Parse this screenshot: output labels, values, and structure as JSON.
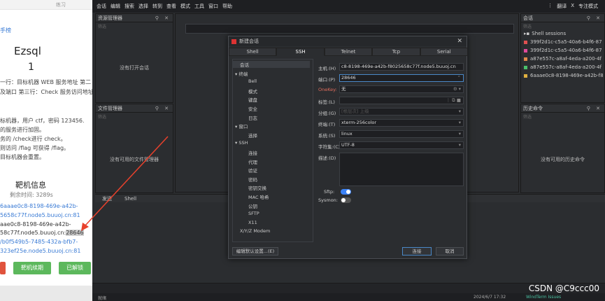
{
  "web": {
    "tab_text": "练习",
    "rank_link": "手榜",
    "challenge_title": "Ezsql",
    "score": "1",
    "desc_lines": [
      "一行：目标机器 WEB 服务地址 第二",
      "及端口 第三行：Check 服务访问地址",
      "标机器，用户 ctf，密码 123456.",
      "的服务进行加固。",
      "务的 /check进行 check。",
      "则访问 /flag 可获得 /flag。",
      "目标机器会重置。"
    ],
    "target_info_title": "靶机信息",
    "time_left": "剩余时间: 3289s",
    "link1a": "6aaae0c8-8198-469e-a42b-",
    "link1b": "5658c77f.node5.buuoj.cn:81",
    "host_line_a": "aae0c8-8198-469e-a42b-",
    "host_line_b": "58c77f.node5.buuoj.cn:",
    "host_port": "28646",
    "link2a": "/b0f549b5-7485-432a-bfb7-",
    "link2b": "323ef25e.node5.buuoj.cn:81",
    "btn_renew": "靶机续期",
    "btn_solved": "已解锁"
  },
  "menubar": {
    "items": [
      "会话",
      "编辑",
      "搜索",
      "选择",
      "转到",
      "查看",
      "模式",
      "工具",
      "窗口",
      "帮助"
    ],
    "right": [
      "翻译",
      "专注模式"
    ]
  },
  "panels": {
    "resource_manager": {
      "title": "资源管理器",
      "filter": "筛选",
      "empty": "没有打开会话"
    },
    "file_manager": {
      "title": "文件管理器",
      "filter": "筛选",
      "empty": "没有可用的文件管理器"
    },
    "sessions": {
      "title": "会话",
      "filter": "筛选",
      "folder": "Shell sessions",
      "items": [
        {
          "label": "399f2d1c-c5a5-40a6-b4f6-87",
          "color": "#e05050"
        },
        {
          "label": "399f2d1c-c5a5-40a6-b4f6-87",
          "color": "#e04a9a"
        },
        {
          "label": "a87e557c-a8af-4eda-a200-4f",
          "color": "#e08a4a"
        },
        {
          "label": "a87e557c-a8af-4eda-a200-4f",
          "color": "#4ac06a"
        },
        {
          "label": "6aaae0c8-8198-469e-a42b-f8",
          "color": "#e0b040"
        }
      ]
    },
    "history": {
      "title": "历史命令",
      "filter": "筛选",
      "empty": "没有可用的历史命令"
    },
    "terminal_tabs": [
      "发送",
      "Shell"
    ]
  },
  "dialog": {
    "title": "新建会话",
    "tabs": [
      "Shell",
      "SSH",
      "Telnet",
      "Tcp",
      "Serial"
    ],
    "active_tab": "SSH",
    "tree": [
      {
        "label": "会话",
        "level": 0,
        "arrow": ""
      },
      {
        "label": "终端",
        "level": 0,
        "arrow": "▾"
      },
      {
        "label": "Bell",
        "level": 1,
        "arrow": ""
      },
      {
        "label": "模式",
        "level": 1,
        "arrow": ""
      },
      {
        "label": "键盘",
        "level": 1,
        "arrow": ""
      },
      {
        "label": "安全",
        "level": 1,
        "arrow": ""
      },
      {
        "label": "日志",
        "level": 1,
        "arrow": ""
      },
      {
        "label": "窗口",
        "level": 0,
        "arrow": "▾"
      },
      {
        "label": "选择",
        "level": 1,
        "arrow": ""
      },
      {
        "label": "SSH",
        "level": 0,
        "arrow": "▾"
      },
      {
        "label": "连接",
        "level": 1,
        "arrow": ""
      },
      {
        "label": "代理",
        "level": 1,
        "arrow": ""
      },
      {
        "label": "验证",
        "level": 1,
        "arrow": ""
      },
      {
        "label": "密码",
        "level": 1,
        "arrow": ""
      },
      {
        "label": "密钥交换",
        "level": 1,
        "arrow": ""
      },
      {
        "label": "MAC 哈希",
        "level": 1,
        "arrow": ""
      },
      {
        "label": "公钥",
        "level": 1,
        "arrow": ""
      },
      {
        "label": "SFTP",
        "level": 1,
        "arrow": ""
      },
      {
        "label": "X11",
        "level": 1,
        "arrow": ""
      },
      {
        "label": "X/Y/Z Modem",
        "level": 0,
        "arrow": ""
      }
    ],
    "fields": {
      "host_label": "主机:(H)",
      "host_value": "c8-8198-469e-a42b-f8025658c77f.node5.buuoj.cn",
      "port_label": "端口:(P)",
      "port_value": "28646",
      "onekey_label": "OneKey:",
      "onekey_value": "无",
      "tag_label": "标签:(L)",
      "tag_value": "",
      "group_label": "分组:(G)",
      "group_value": "[根层次] 上级",
      "term_label": "终端:(T)",
      "term_value": "xterm-256color",
      "system_label": "系统:(S)",
      "system_value": "linux",
      "charset_label": "字符集:(C)",
      "charset_value": "UTF-8",
      "desc_label": "描述:(D)",
      "sftp_label": "Sftp:",
      "sftp_on": true,
      "sysmon_label": "Sysmon:",
      "sysmon_on": false
    },
    "edit_defaults": "编辑默认设置...(E)",
    "connect": "连接",
    "cancel": "取消"
  },
  "status": {
    "left": "就绪",
    "datetime": "2024/6/7 17:32",
    "right": "WindTerm Issues"
  },
  "watermark": "CSDN @C9ccc00"
}
